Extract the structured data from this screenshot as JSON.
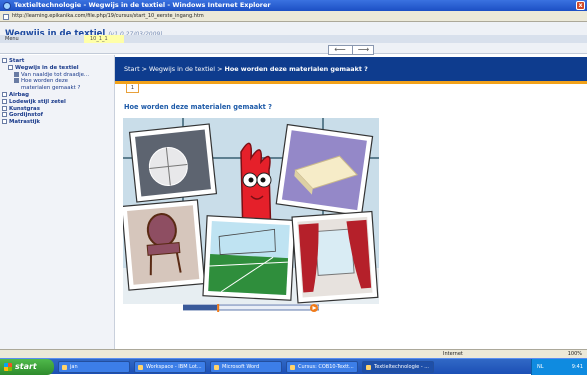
{
  "window": {
    "title": "Textieltechnologie - Wegwijs in de textiel - Windows Internet Explorer",
    "close_label": "x"
  },
  "browser": {
    "address": "http://learning.epikanika.com/file.php/19/cursus/start_10_eerste_ingang.htm"
  },
  "app": {
    "title": "Wegwijs in de textiel",
    "version": "(v1.0 27/03/2009)",
    "menu_label": "Menu",
    "page_code": "10_1_1"
  },
  "nav": {
    "back": "⟵",
    "forward": "⟶"
  },
  "sidebar": {
    "items": [
      {
        "label": "Start",
        "kind": "folder",
        "level": 0
      },
      {
        "label": "Wegwijs in de textiel",
        "kind": "folder",
        "level": 1
      },
      {
        "label": "Van naaldje tot draadje...",
        "kind": "doc",
        "level": 2
      },
      {
        "label": "Hoe worden deze",
        "kind": "doc",
        "level": 2
      },
      {
        "label": "materialen gemaakt ?",
        "kind": "cont",
        "level": 2
      },
      {
        "label": "Airbag",
        "kind": "folder",
        "level": 0
      },
      {
        "label": "Lodewijk stijl zetel",
        "kind": "folder",
        "level": 0
      },
      {
        "label": "Kunstgras",
        "kind": "folder",
        "level": 0
      },
      {
        "label": "Gordijnstof",
        "kind": "folder",
        "level": 0
      },
      {
        "label": "Matrastijk",
        "kind": "folder",
        "level": 0
      }
    ]
  },
  "content": {
    "breadcrumb_path": "Start > Wegwijs in de textiel > ",
    "breadcrumb_current": "Hoe worden deze materialen gemaakt ?",
    "page_tab": "1",
    "heading": "Hoe worden deze materialen gemaakt ?",
    "slider_position": 0.28
  },
  "status": {
    "zone": "Internet",
    "zoom": "100%"
  },
  "taskbar": {
    "start_label": "start",
    "buttons": [
      "jan",
      "Workspace - IBM Lot...",
      "Microsoft Word",
      "Cursus: COB10-Textt...",
      "Textieltechnologie - ..."
    ],
    "tray_text": "NL",
    "clock": "9:41"
  },
  "colors": {
    "accent_blue": "#0e3c8e",
    "accent_orange": "#f2a21a",
    "sidebar_bg": "#f1f3f8"
  }
}
